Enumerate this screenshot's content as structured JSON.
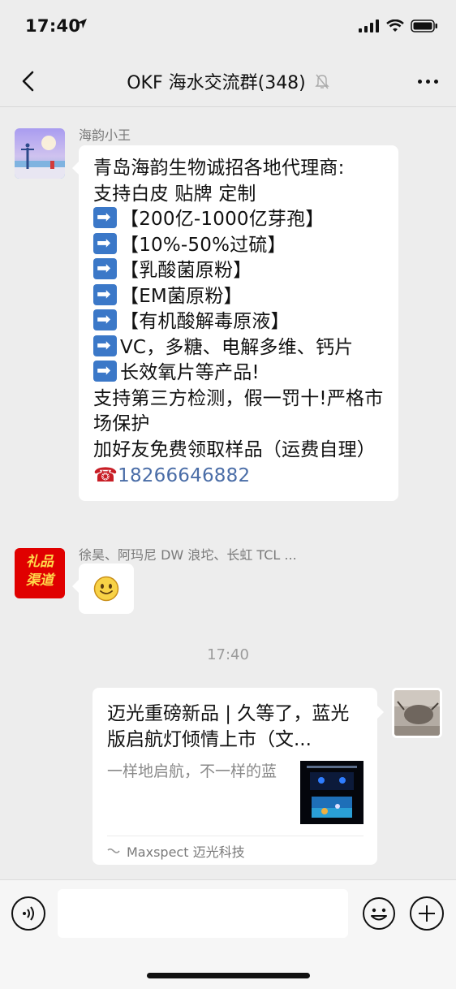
{
  "status_bar": {
    "time": "17:40"
  },
  "header": {
    "title": "OKF 海水交流群(348)"
  },
  "messages": [
    {
      "sender": "海韵小王",
      "lines": [
        {
          "text": "青岛海韵生物诚招各地代理商:",
          "arrow": false
        },
        {
          "text": " 支持白皮 贴牌 定制",
          "arrow": false
        },
        {
          "text": "【200亿-1000亿芽孢】",
          "arrow": true
        },
        {
          "text": "【10%-50%过硫】",
          "arrow": true
        },
        {
          "text": "【乳酸菌原粉】",
          "arrow": true
        },
        {
          "text": "【EM菌原粉】",
          "arrow": true
        },
        {
          "text": "【有机酸解毒原液】",
          "arrow": true
        },
        {
          "text": "VC，多糖、电解多维、钙片",
          "arrow": true
        },
        {
          "text": "长效氧片等产品!",
          "arrow": true
        },
        {
          "text": "支持第三方检测，假一罚十!严格市场保护",
          "arrow": false,
          "wrap": true
        },
        {
          "text": "加好友免费领取样品（运费自理）",
          "arrow": false,
          "wrap": true
        }
      ],
      "phone_icon": "☎",
      "phone": "18266646882"
    },
    {
      "sender": "徐昊、阿玛尼 DW 浪坨、长虹 TCL ...",
      "avatar_text": [
        "礼品",
        "渠道"
      ],
      "emoji": "smile-emoji"
    }
  ],
  "timestamp": "17:40",
  "shared_card": {
    "title": "迈光重磅新品 | 久等了，蓝光版启航灯倾情上市（文...",
    "description": "一样地启航，不一样的蓝",
    "source": "Maxspect 迈光科技"
  },
  "input": {
    "value": "",
    "placeholder": ""
  },
  "colors": {
    "background": "#ededed",
    "link": "#4a6da7",
    "bubble": "#ffffff"
  }
}
